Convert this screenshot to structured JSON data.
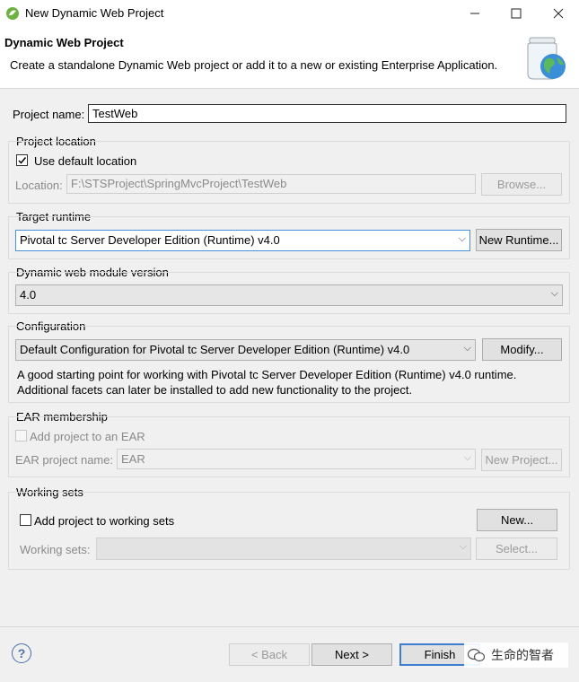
{
  "window": {
    "title": "New Dynamic Web Project"
  },
  "banner": {
    "title": "Dynamic Web Project",
    "description": "Create a standalone Dynamic Web project or add it to a new or existing Enterprise Application."
  },
  "project_name": {
    "label": "Project name:",
    "value": "TestWeb"
  },
  "project_location": {
    "group_label": "Project location",
    "use_default_label": "Use default location",
    "use_default_checked": true,
    "location_label": "Location:",
    "location_value": "F:\\STSProject\\SpringMvcProject\\TestWeb",
    "browse_label": "Browse..."
  },
  "target_runtime": {
    "group_label": "Target runtime",
    "selected": "Pivotal tc Server Developer Edition (Runtime) v4.0",
    "new_runtime_label": "New Runtime..."
  },
  "web_module": {
    "group_label": "Dynamic web module version",
    "selected": "4.0"
  },
  "configuration": {
    "group_label": "Configuration",
    "selected": "Default Configuration for Pivotal tc Server Developer Edition (Runtime) v4.0",
    "modify_label": "Modify...",
    "description_line1": "A good starting point for working with Pivotal tc Server Developer Edition (Runtime) v4.0 runtime.",
    "description_line2": "Additional facets can later be installed to add new functionality to the project."
  },
  "ear": {
    "group_label": "EAR membership",
    "add_label": "Add project to an EAR",
    "name_label": "EAR project name:",
    "name_value": "EAR",
    "new_project_label": "New Project..."
  },
  "working_sets": {
    "group_label": "Working sets",
    "add_label": "Add project to working sets",
    "new_label": "New...",
    "sets_label": "Working sets:",
    "select_label": "Select..."
  },
  "footer": {
    "help_symbol": "?",
    "back_label": "< Back",
    "next_label": "Next >",
    "finish_label": "Finish",
    "watermark": "生命的智者"
  },
  "colors": {
    "accent": "#3c7fd1",
    "background": "#f0f0f0"
  }
}
